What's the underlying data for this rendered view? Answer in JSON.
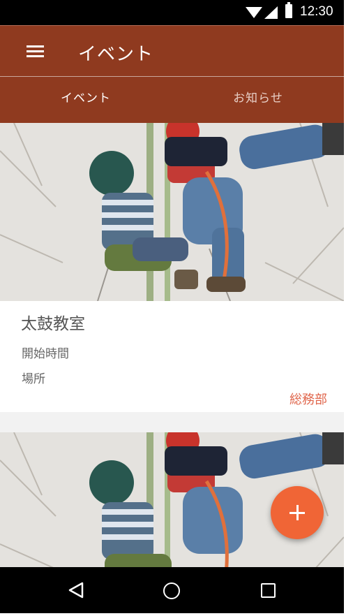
{
  "status_bar": {
    "time": "12:30"
  },
  "app_bar": {
    "title": "イベント"
  },
  "tabs": [
    {
      "label": "イベント",
      "selected": true
    },
    {
      "label": "お知らせ",
      "selected": false
    }
  ],
  "cards": [
    {
      "title": "太鼓教室",
      "start_label": "開始時間",
      "place_label": "場所",
      "department": "総務部"
    },
    {
      "title": "",
      "start_label": "",
      "place_label": "",
      "department": ""
    }
  ],
  "colors": {
    "primary": "#8f3a1f",
    "accent": "#f06536",
    "department_text": "#e0664c"
  },
  "icons": {
    "menu": "menu-icon",
    "fab": "plus-icon",
    "back": "back-icon",
    "home": "home-icon",
    "recent": "recent-apps-icon"
  }
}
